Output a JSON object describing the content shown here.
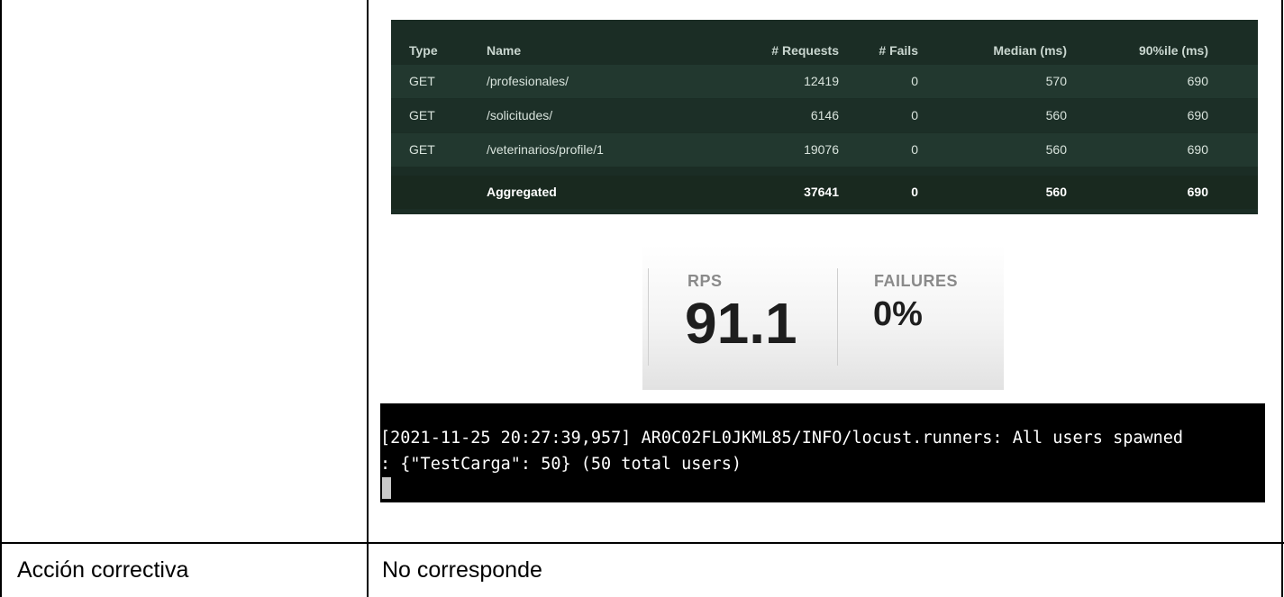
{
  "stats_table": {
    "headers": [
      "Type",
      "Name",
      "# Requests",
      "# Fails",
      "Median (ms)",
      "90%ile (ms)"
    ],
    "rows": [
      {
        "type": "GET",
        "name": "/profesionales/",
        "requests": "12419",
        "fails": "0",
        "median": "570",
        "p90": "690"
      },
      {
        "type": "GET",
        "name": "/solicitudes/",
        "requests": "6146",
        "fails": "0",
        "median": "560",
        "p90": "690"
      },
      {
        "type": "GET",
        "name": "/veterinarios/profile/1",
        "requests": "19076",
        "fails": "0",
        "median": "560",
        "p90": "690"
      }
    ],
    "aggregated": {
      "type": "",
      "name": "Aggregated",
      "requests": "37641",
      "fails": "0",
      "median": "560",
      "p90": "690"
    }
  },
  "metrics": {
    "rps_label": "RPS",
    "rps_value": "91.1",
    "failures_label": "FAILURES",
    "failures_value": "0%"
  },
  "terminal": {
    "line1": "[2021-11-25 20:27:39,957] AR0C02FL0JKML85/INFO/locust.runners: All users spawned",
    "line2": ": {\"TestCarga\": 50} (50 total users)"
  },
  "doc_table": {
    "row_label": "Acción correctiva",
    "row_value": "No corresponde"
  },
  "colors": {
    "table_bg": "#1b2d25",
    "row_alt": "#22382f",
    "terminal_bg": "#000000"
  }
}
